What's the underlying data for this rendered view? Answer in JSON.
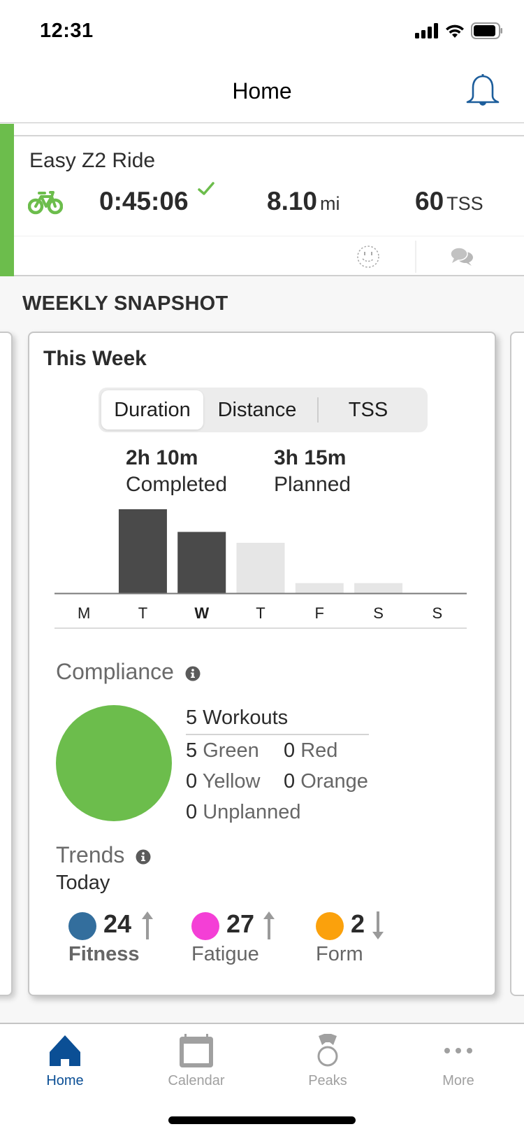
{
  "status_bar": {
    "time": "12:31"
  },
  "header": {
    "title": "Home",
    "notification_icon": "bell-icon"
  },
  "workout": {
    "title": "Easy Z2 Ride",
    "sport_icon": "bike-icon",
    "duration": "0:45:06",
    "completed_icon": "checkmark-icon",
    "distance_value": "8.10",
    "distance_unit": "mi",
    "tss_value": "60",
    "tss_unit": "TSS",
    "feel_icon": "smiley-icon",
    "comments_icon": "chat-bubbles-icon"
  },
  "weekly_snapshot": {
    "section_title": "WEEKLY SNAPSHOT",
    "card_title": "This Week",
    "segments": [
      "Duration",
      "Distance",
      "TSS"
    ],
    "active_segment": "Duration",
    "completed": {
      "value": "2h 10m",
      "label": "Completed"
    },
    "planned": {
      "value": "3h 15m",
      "label": "Planned"
    },
    "compliance": {
      "title": "Compliance",
      "total": "5 Workouts",
      "items": [
        {
          "count": "5",
          "label": "Green"
        },
        {
          "count": "0",
          "label": "Red"
        },
        {
          "count": "0",
          "label": "Yellow"
        },
        {
          "count": "0",
          "label": "Orange"
        },
        {
          "count": "0",
          "label": "Unplanned"
        }
      ],
      "pie_color": "#6cbd4c"
    },
    "trends": {
      "title": "Trends",
      "subtitle": "Today",
      "metrics": [
        {
          "value": "24",
          "label": "Fitness",
          "color": "#336e9d",
          "direction": "up"
        },
        {
          "value": "27",
          "label": "Fatigue",
          "color": "#f43fd6",
          "direction": "up"
        },
        {
          "value": "2",
          "label": "Form",
          "color": "#fba10c",
          "direction": "down"
        }
      ]
    }
  },
  "chart_data": {
    "type": "bar",
    "title": "This Week — Duration",
    "categories": [
      "M",
      "T",
      "W",
      "T",
      "F",
      "S",
      "S"
    ],
    "current_day_index": 2,
    "series": [
      {
        "name": "Completed",
        "color": "#4a4a4a",
        "values": [
          0,
          1.0,
          0.73,
          0,
          0,
          0,
          0
        ]
      },
      {
        "name": "Planned",
        "color": "#e6e6e6",
        "values": [
          0,
          0,
          0,
          0.6,
          0.12,
          0.12,
          0
        ]
      }
    ],
    "ylim": [
      0,
      1.0
    ],
    "units": "relative duration"
  },
  "tab_bar": {
    "tabs": [
      {
        "label": "Home",
        "icon": "home-icon",
        "active": true
      },
      {
        "label": "Calendar",
        "icon": "calendar-icon",
        "active": false
      },
      {
        "label": "Peaks",
        "icon": "medal-icon",
        "active": false
      },
      {
        "label": "More",
        "icon": "more-icon",
        "active": false
      }
    ],
    "active_color": "#0b4f95",
    "inactive_color": "#a0a0a0"
  }
}
